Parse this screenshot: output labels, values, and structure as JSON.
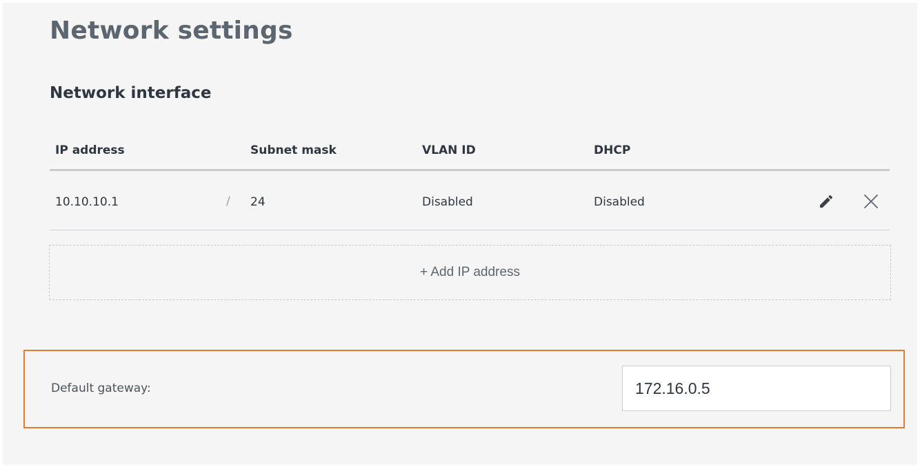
{
  "page": {
    "title": "Network settings"
  },
  "network_interface": {
    "title": "Network interface",
    "columns": {
      "ip_address": "IP address",
      "subnet_mask": "Subnet mask",
      "vlan_id": "VLAN ID",
      "dhcp": "DHCP"
    },
    "rows": [
      {
        "ip_address": "10.10.10.1",
        "separator": "/",
        "subnet_mask": "24",
        "vlan_id": "Disabled",
        "dhcp": "Disabled",
        "edit_icon": "pencil-icon",
        "delete_icon": "close-icon"
      }
    ],
    "add_label": "+ Add IP address"
  },
  "gateway": {
    "label": "Default gateway:",
    "value": "172.16.0.5"
  },
  "colors": {
    "highlight_border": "#e8782e",
    "panel_background": "#f5f5f5",
    "heading_text": "#5c6670",
    "body_text": "#2e3740"
  }
}
